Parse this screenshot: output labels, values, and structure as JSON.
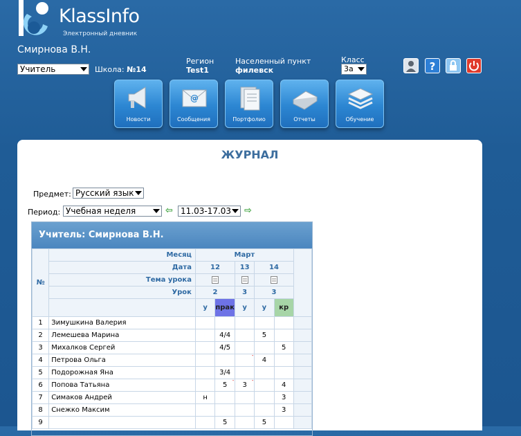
{
  "brand": {
    "name": "KlassInfo",
    "subtitle": "Электронный дневник"
  },
  "user": {
    "name": "Смирнова В.Н."
  },
  "role": {
    "selected": "Учитель"
  },
  "school": {
    "label": "Школа:",
    "value": "№14"
  },
  "region": {
    "label": "Регион",
    "value": "Test1"
  },
  "locality": {
    "label": "Населенный пункт",
    "value": "филевск"
  },
  "class_field": {
    "label": "Класс",
    "selected": "3а"
  },
  "nav": [
    {
      "label": "Новости",
      "icon": "megaphone-icon"
    },
    {
      "label": "Сообщения",
      "icon": "envelope-icon"
    },
    {
      "label": "Портфолио",
      "icon": "documents-icon"
    },
    {
      "label": "Отчеты",
      "icon": "book-icon"
    },
    {
      "label": "Обучение",
      "icon": "stack-icon"
    }
  ],
  "page": {
    "title": "ЖУРНАЛ"
  },
  "filters": {
    "subject_label": "Предмет:",
    "subject": "Русский язык",
    "period_label": "Период:",
    "period": "Учебная неделя",
    "week": "11.03-17.03"
  },
  "journal": {
    "title": "Учитель: Смирнова В.Н.",
    "labels": {
      "month": "Месяц",
      "date": "Дата",
      "topic": "Тема урока",
      "lesson": "Урок",
      "num": "№"
    },
    "month": "Март",
    "dates": [
      "12",
      "13",
      "14"
    ],
    "lessons": [
      "2",
      "3",
      "3"
    ],
    "columns": [
      "у",
      "прак",
      "у",
      "у",
      "кр"
    ],
    "students": [
      {
        "n": "1",
        "name": "Зимушкина Валерия",
        "marks": [
          "",
          "",
          "",
          "",
          ""
        ]
      },
      {
        "n": "2",
        "name": "Лемешева Марина",
        "marks": [
          "",
          "4/4",
          "",
          "5",
          ""
        ]
      },
      {
        "n": "3",
        "name": "Михалков Сергей",
        "marks": [
          "",
          "4/5",
          "",
          "",
          "5"
        ]
      },
      {
        "n": "4",
        "name": "Петрова Ольга",
        "marks": [
          "",
          "",
          "",
          "4",
          ""
        ]
      },
      {
        "n": "5",
        "name": "Подорожная Яна",
        "marks": [
          "",
          "3/4",
          "",
          "",
          ""
        ]
      },
      {
        "n": "6",
        "name": "Попова Татьяна",
        "marks": [
          "",
          "5",
          "3",
          "",
          "4"
        ]
      },
      {
        "n": "7",
        "name": "Симаков Андрей",
        "marks": [
          "н",
          "",
          "",
          "",
          "3"
        ]
      },
      {
        "n": "8",
        "name": "Снежко Максим",
        "marks": [
          "",
          "",
          "",
          "",
          "3"
        ]
      },
      {
        "n": "9",
        "name": "",
        "marks": [
          "",
          "5",
          "",
          "5",
          ""
        ]
      }
    ]
  },
  "colors": {
    "accent": "#2f6aa3",
    "prac": "#6e73e6",
    "kr": "#a7d5a7",
    "title": "#3d6e9e"
  }
}
